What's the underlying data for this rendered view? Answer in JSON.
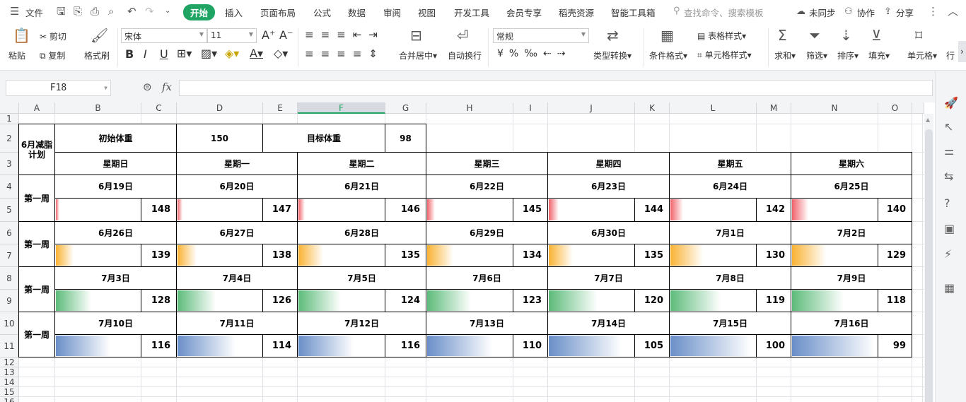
{
  "tabbar": {
    "menu_label": "文件",
    "tabs": [
      "开始",
      "插入",
      "页面布局",
      "公式",
      "数据",
      "审阅",
      "视图",
      "开发工具",
      "会员专享",
      "稻壳资源",
      "智能工具箱"
    ],
    "search_placeholder": "查找命令、搜索模板",
    "sync": "未同步",
    "collab": "协作",
    "share": "分享"
  },
  "ribbon": {
    "paste": "粘贴",
    "cut": "剪切",
    "copy": "复制",
    "format_painter": "格式刷",
    "font": "宋体",
    "font_size": "11",
    "merge_center": "合并居中",
    "wrap": "自动换行",
    "number_format": "常规",
    "type_convert": "类型转换",
    "cond_format": "条件格式",
    "table_style": "表格样式",
    "cell_style": "单元格样式",
    "sum": "求和",
    "filter": "筛选",
    "sort": "排序",
    "fill": "填充",
    "cell": "单元格",
    "row_col": "行"
  },
  "formula_bar": {
    "name_box": "F18",
    "formula": ""
  },
  "columns": [
    "A",
    "B",
    "C",
    "D",
    "E",
    "F",
    "G",
    "H",
    "I",
    "J",
    "K",
    "L",
    "M",
    "N",
    "O"
  ],
  "selected_column": "F",
  "rows": [
    "1",
    "2",
    "3",
    "4",
    "5",
    "6",
    "7",
    "8",
    "9",
    "10",
    "11",
    "12",
    "13",
    "14",
    "15",
    "16"
  ],
  "sheet": {
    "title": "6月减脂计划",
    "initial_label": "初始体重",
    "initial_weight": "150",
    "target_label": "目标体重",
    "target_weight": "98",
    "days": [
      "星期日",
      "星期一",
      "星期二",
      "星期三",
      "星期四",
      "星期五",
      "星期六"
    ],
    "weeks": [
      {
        "label": "第一周",
        "color": "#f0636b",
        "dates": [
          "6月19日",
          "6月20日",
          "6月21日",
          "6月22日",
          "6月23日",
          "6月24日",
          "6月25日"
        ],
        "weights": [
          "148",
          "147",
          "146",
          "145",
          "144",
          "142",
          "140"
        ]
      },
      {
        "label": "第一周",
        "color": "#f9b233",
        "dates": [
          "6月26日",
          "6月27日",
          "6月28日",
          "6月29日",
          "6月30日",
          "7月1日",
          "7月2日"
        ],
        "weights": [
          "139",
          "138",
          "135",
          "134",
          "135",
          "130",
          "129"
        ]
      },
      {
        "label": "第一周",
        "color": "#5dbb7a",
        "dates": [
          "7月3日",
          "7月4日",
          "7月5日",
          "7月6日",
          "7月7日",
          "7月8日",
          "7月9日"
        ],
        "weights": [
          "128",
          "126",
          "124",
          "123",
          "120",
          "119",
          "118"
        ]
      },
      {
        "label": "第一周",
        "color": "#6a8fc8",
        "dates": [
          "7月10日",
          "7月11日",
          "7月12日",
          "7月13日",
          "7月14日",
          "7月15日",
          "7月16日"
        ],
        "weights": [
          "116",
          "114",
          "116",
          "110",
          "105",
          "100",
          "99"
        ]
      }
    ]
  }
}
